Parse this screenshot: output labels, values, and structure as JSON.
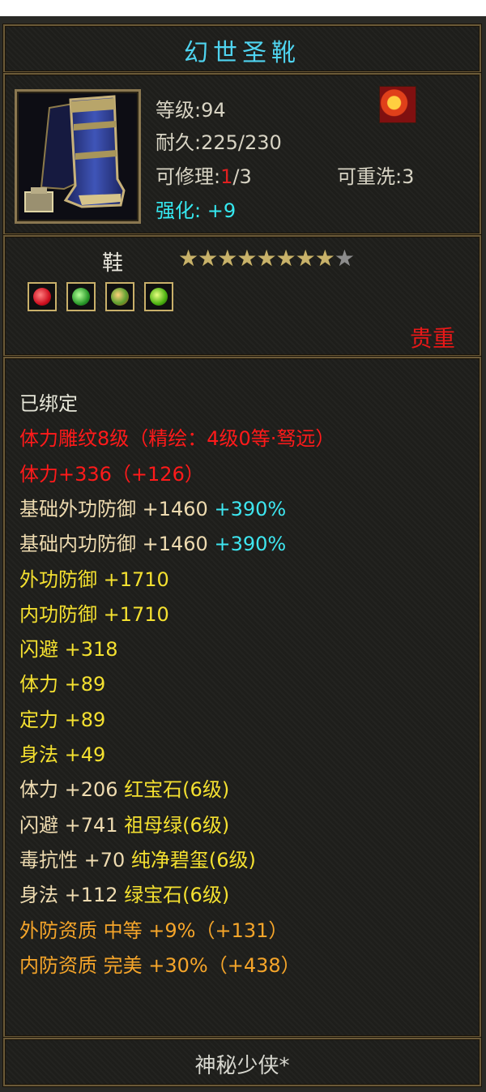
{
  "item": {
    "name": "幻世圣靴",
    "level_text": "等级:94",
    "durability_text": "耐久:225/230",
    "repair_label": "可修理:",
    "repair_used": "1",
    "repair_total": "/3",
    "rewash_text": "可重洗:3",
    "enhance_label": "强化:",
    "enhance_value": "+9",
    "type": "鞋",
    "stars": {
      "filled": 8,
      "total": 9
    },
    "rarity": "贵重",
    "gems": [
      "red-gem-icon",
      "green-gem-icon",
      "orange-green-gem-icon",
      "lime-gem-icon"
    ]
  },
  "stats": [
    {
      "segments": [
        {
          "text": "已绑定",
          "color": "white"
        }
      ]
    },
    {
      "segments": [
        {
          "text": "体力雕纹8级（精绘：4级0等·驽远）",
          "color": "red"
        }
      ]
    },
    {
      "segments": [
        {
          "text": "体力+336（+126）",
          "color": "red"
        }
      ]
    },
    {
      "segments": [
        {
          "text": "基础外功防御 +1460 ",
          "color": "wheat"
        },
        {
          "text": "+390%",
          "color": "cyan"
        }
      ]
    },
    {
      "segments": [
        {
          "text": "基础内功防御 +1460 ",
          "color": "wheat"
        },
        {
          "text": "+390%",
          "color": "cyan"
        }
      ]
    },
    {
      "segments": [
        {
          "text": "外功防御 +1710",
          "color": "yellow"
        }
      ]
    },
    {
      "segments": [
        {
          "text": "内功防御 +1710",
          "color": "yellow"
        }
      ]
    },
    {
      "segments": [
        {
          "text": "闪避 +318",
          "color": "yellow"
        }
      ]
    },
    {
      "segments": [
        {
          "text": "体力 +89",
          "color": "yellow"
        }
      ]
    },
    {
      "segments": [
        {
          "text": "定力 +89",
          "color": "yellow"
        }
      ]
    },
    {
      "segments": [
        {
          "text": "身法 +49",
          "color": "yellow"
        }
      ]
    },
    {
      "segments": [
        {
          "text": "体力 +206 ",
          "color": "wheat"
        },
        {
          "text": "红宝石(6级)",
          "color": "yellow"
        }
      ]
    },
    {
      "segments": [
        {
          "text": "闪避 +741 ",
          "color": "wheat"
        },
        {
          "text": "祖母绿(6级)",
          "color": "yellow"
        }
      ]
    },
    {
      "segments": [
        {
          "text": "毒抗性 +70 ",
          "color": "wheat"
        },
        {
          "text": "纯净碧玺(6级)",
          "color": "yellow"
        }
      ]
    },
    {
      "segments": [
        {
          "text": "身法 +112 ",
          "color": "wheat"
        },
        {
          "text": "绿宝石(6级)",
          "color": "yellow"
        }
      ]
    },
    {
      "segments": [
        {
          "text": "外防资质  中等 +9%（+131）",
          "color": "orange"
        }
      ]
    },
    {
      "segments": [
        {
          "text": "内防资质  完美 +30%（+438）",
          "color": "orange"
        }
      ]
    }
  ],
  "footer": "神秘少侠*",
  "colors": {
    "white": "#e6e6d8",
    "red": "#ff1a1a",
    "cyan": "#3ee6f0",
    "yellow": "#f4e030",
    "orange": "#f5a52a",
    "wheat": "#eedbb0",
    "frame_border": "#6b5a38",
    "title": "#4fd4f0",
    "rarity": "#e81818"
  }
}
